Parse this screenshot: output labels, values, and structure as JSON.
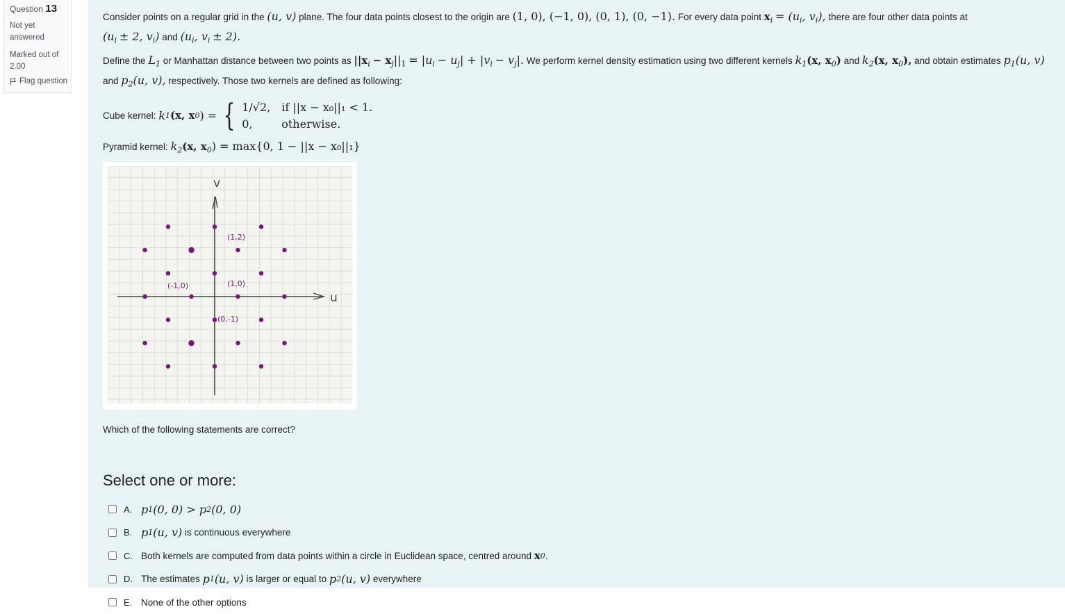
{
  "info": {
    "question_word": "Question",
    "question_number": "13",
    "state": "Not yet answered",
    "marked_out_of_label": "Marked out of",
    "marked_out_of_value": "2.00",
    "flag_label": "Flag question"
  },
  "question": {
    "p1_t1": "Consider points on a regular grid in the",
    "p1_m1": "(u, v)",
    "p1_t2": "plane. The four data points closest to the origin are",
    "p1_m2": "(1, 0), (−1, 0), (0, 1), (0, −1).",
    "p1_t3": "For every data point",
    "p1_m3": "x",
    "p1_m3b": "i",
    "p1_m4": "= (u",
    "p1_m4b": "i",
    "p1_m4c": ", v",
    "p1_m4d": "i",
    "p1_m4e": "),",
    "p1_t4": "there are four other data points at",
    "p1_m5": "(u",
    "p1_m5b": "i",
    "p1_m5c": "± 2, v",
    "p1_m5d": "i",
    "p1_m5e": ")",
    "p1_t5": "and",
    "p1_m6": "(u",
    "p1_m6b": "i",
    "p1_m6c": ", v",
    "p1_m6d": "i",
    "p1_m6e": "± 2).",
    "p2_t1": "Define the",
    "p2_m1": "L",
    "p2_m1b": "1",
    "p2_t2": "or Manhattan distance between two points as",
    "p2_m2": "||x",
    "p2_m2b": "i",
    "p2_m2c": "− x",
    "p2_m2d": "j",
    "p2_m2e": "||",
    "p2_m2f": "1",
    "p2_m2g": "= |u",
    "p2_m2h": "i",
    "p2_m2i": "− u",
    "p2_m2j": "j",
    "p2_m2k": "| + |v",
    "p2_m2l": "i",
    "p2_m2m": "− v",
    "p2_m2n": "j",
    "p2_m2o": "|.",
    "p2_t3": "We perform kernel density estimation using two different kernels",
    "p2_m3": "k",
    "p2_m3b": "1",
    "p2_m3c": "(x, x",
    "p2_m3d": "0",
    "p2_m3e": ")",
    "p2_t4": "and",
    "p2_m4": "k",
    "p2_m4b": "2",
    "p2_m4c": "(x, x",
    "p2_m4d": "0",
    "p2_m4e": "),",
    "p2_t5": "and obtain estimates",
    "p2_m5": "p",
    "p2_m5b": "1",
    "p2_m5c": "(u, v)",
    "p2_t6": "and",
    "p2_m6": "p",
    "p2_m6b": "2",
    "p2_m6c": "(u, v),",
    "p2_t7": "respectively. Those two kernels are defined as following:",
    "cube_label": "Cube kernel:",
    "cube_lhs": "k",
    "cube_lhs_sub": "1",
    "cube_lhs_rest": "(x, x",
    "cube_lhs_sub0": "0",
    "cube_lhs_end": ") =",
    "cube_case1_val": "1/√2,",
    "cube_case1_cond": "if   ||x − x₀||₁ < 1.",
    "cube_case2_val": "0,",
    "cube_case2_cond": "otherwise.",
    "pyr_label": "Pyramid kernel:",
    "pyr_lhs": "k",
    "pyr_lhs_sub": "2",
    "pyr_lhs_rest": "(x, x",
    "pyr_lhs_sub0": "0",
    "pyr_rhs": ") = max{0, 1 − ||x − x₀||₁}",
    "question_text": "Which of the following statements are correct?"
  },
  "sketch": {
    "v_label": "v",
    "u_label": "u",
    "labels": [
      "(1,2)",
      "(1,0)",
      "(-1,0)",
      "(0,-1)"
    ],
    "ink_color": "#7a1677",
    "axis_color": "#444444",
    "grid_color": "#dcdcdc",
    "paper_color": "#f5f5ef"
  },
  "answers": {
    "prompt": "Select one or more:",
    "options": [
      {
        "letter": "A.",
        "m": "p",
        "mb": "1",
        "mc": "(0, 0) > p",
        "md": "2",
        "me": "(0, 0)",
        "t": ""
      },
      {
        "letter": "B.",
        "m": "p",
        "mb": "1",
        "mc": "(u, v)",
        "md": "",
        "me": "",
        "t": "is continuous everywhere"
      },
      {
        "letter": "C.",
        "pre": "Both kernels are computed from data points within a circle in Euclidean space, centred around",
        "x0": "x",
        "x0b": "0",
        "post": "."
      },
      {
        "letter": "D.",
        "pre": "The estimates",
        "m": "p",
        "mb": "1",
        "mc": "(u, v)",
        "mid": "is larger or equal to",
        "n": "p",
        "nb": "2",
        "nc": "(u, v)",
        "post": "everywhere"
      },
      {
        "letter": "E.",
        "t": "None of the other options"
      }
    ]
  }
}
